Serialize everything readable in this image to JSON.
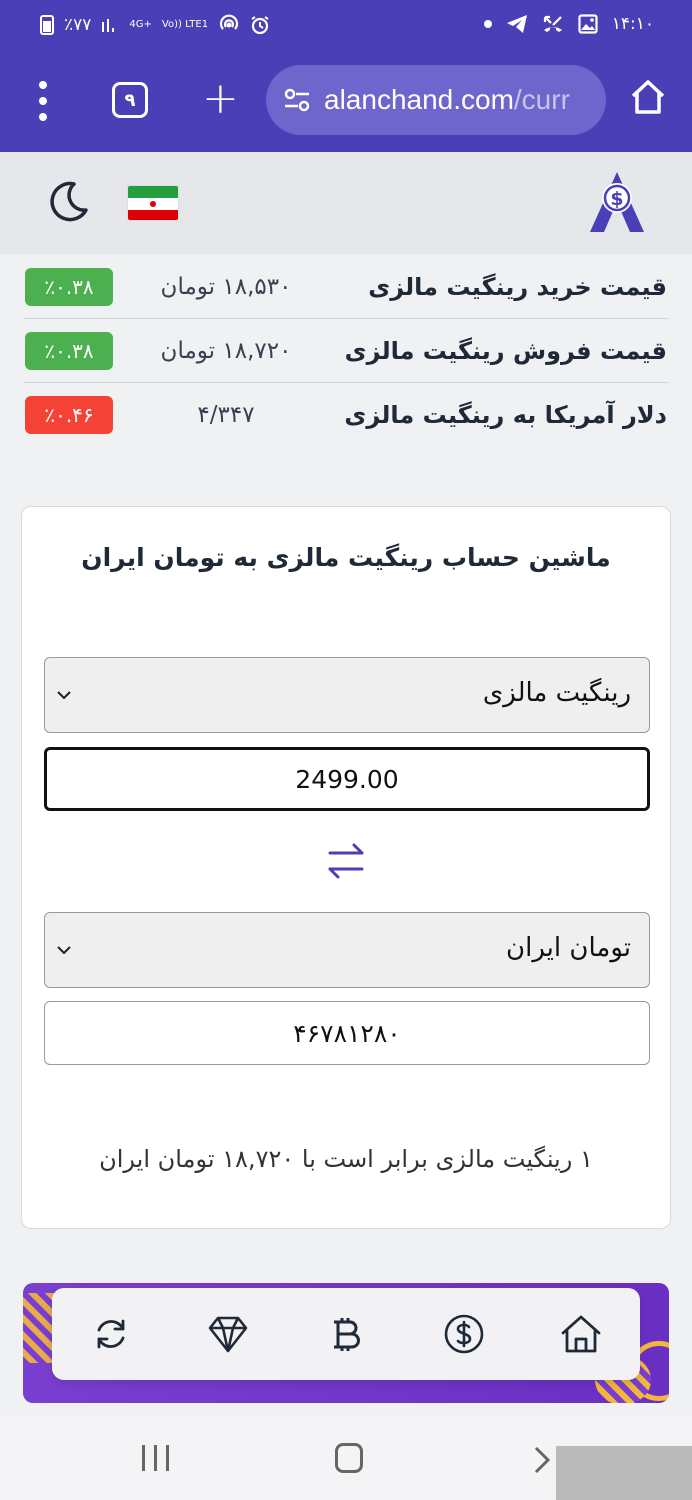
{
  "status_bar": {
    "battery": "٪۷۷",
    "network_1": "4G+",
    "network_2": "Vo)) LTE1",
    "time": "۱۴:۱۰"
  },
  "browser": {
    "tab_count": "۹",
    "url_main": "alanchand.com",
    "url_rest": "/curr"
  },
  "prices": [
    {
      "label": "قیمت خرید رینگیت مالزی",
      "value": "۱۸,۵۳۰ تومان",
      "change": "٪۰.۳۸",
      "direction": "up"
    },
    {
      "label": "قیمت فروش رینگیت مالزی",
      "value": "۱۸,۷۲۰ تومان",
      "change": "٪۰.۳۸",
      "direction": "up"
    },
    {
      "label": "دلار آمریکا به رینگیت مالزی",
      "value": "۴/۳۴۷",
      "change": "٪۰.۴۶",
      "direction": "down"
    }
  ],
  "calculator": {
    "title": "ماشین حساب رینگیت مالزی به تومان ایران",
    "from_currency": "رینگیت مالزی",
    "amount": "2499.00",
    "to_currency": "تومان ایران",
    "result": "۴۶۷۸۱۲۸۰",
    "rate_note": "۱ رینگیت مالزی برابر است با ۱۸,۷۲۰ تومان ایران"
  },
  "colors": {
    "brand": "#4a3fb6",
    "up": "#4caf50",
    "down": "#f44336"
  },
  "bottom_nav": [
    "refresh-icon",
    "diamond-icon",
    "bitcoin-icon",
    "dollar-icon",
    "home-icon"
  ]
}
